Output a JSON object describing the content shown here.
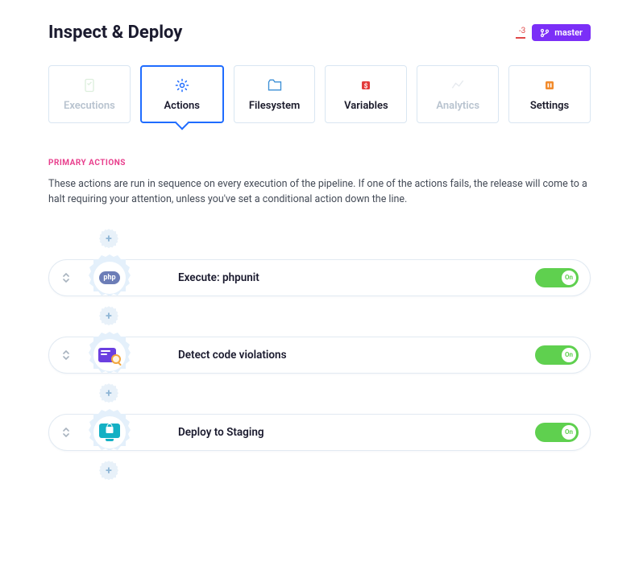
{
  "header": {
    "title": "Inspect & Deploy",
    "status_count": "-3",
    "branch_label": "master"
  },
  "tabs": [
    {
      "label": "Executions",
      "icon": "executions",
      "state": "disabled"
    },
    {
      "label": "Actions",
      "icon": "actions",
      "state": "active"
    },
    {
      "label": "Filesystem",
      "icon": "filesystem",
      "state": "normal"
    },
    {
      "label": "Variables",
      "icon": "variables",
      "state": "normal"
    },
    {
      "label": "Analytics",
      "icon": "analytics",
      "state": "disabled"
    },
    {
      "label": "Settings",
      "icon": "settings",
      "state": "normal"
    }
  ],
  "section": {
    "title": "PRIMARY ACTIONS",
    "description": "These actions are run in sequence on every execution of the pipeline. If one of the actions fails, the release will come to a halt requiring your attention, unless you've set a conditional action down the line."
  },
  "actions": [
    {
      "label": "Execute: phpunit",
      "icon": "php",
      "toggle_label": "On",
      "enabled": true
    },
    {
      "label": "Detect code violations",
      "icon": "violate",
      "toggle_label": "On",
      "enabled": true
    },
    {
      "label": "Deploy to Staging",
      "icon": "deploy",
      "toggle_label": "On",
      "enabled": true
    }
  ]
}
